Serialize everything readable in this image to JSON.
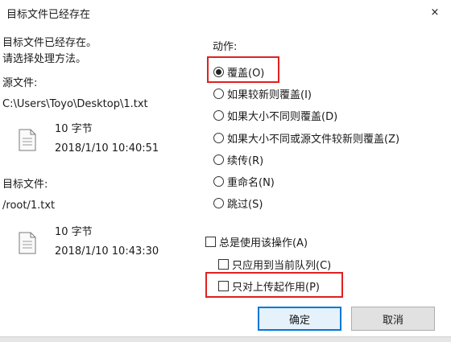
{
  "window": {
    "title": "目标文件已经存在",
    "close_glyph": "×"
  },
  "intro": {
    "line1": "目标文件已经存在。",
    "line2": "请选择处理方法。"
  },
  "source": {
    "label": "源文件:",
    "path": "C:\\Users\\Toyo\\Desktop\\1.txt",
    "size": "10 字节",
    "date": "2018/1/10 10:40:51",
    "icon": "file-icon"
  },
  "target": {
    "label": "目标文件:",
    "path": "/root/1.txt",
    "size": "10 字节",
    "date": "2018/1/10 10:43:30",
    "icon": "file-icon"
  },
  "action": {
    "label": "动作:",
    "options": [
      {
        "label": "覆盖(O)",
        "checked": true
      },
      {
        "label": "如果较新则覆盖(I)",
        "checked": false
      },
      {
        "label": "如果大小不同则覆盖(D)",
        "checked": false
      },
      {
        "label": "如果大小不同或源文件较新则覆盖(Z)",
        "checked": false
      },
      {
        "label": "续传(R)",
        "checked": false
      },
      {
        "label": "重命名(N)",
        "checked": false
      },
      {
        "label": "跳过(S)",
        "checked": false
      }
    ]
  },
  "options": {
    "always": {
      "label": "总是使用该操作(A)",
      "checked": false
    },
    "queue_only": {
      "label": "只应用到当前队列(C)",
      "checked": false
    },
    "upload_only": {
      "label": "只对上传起作用(P)",
      "checked": false
    }
  },
  "buttons": {
    "ok": "确定",
    "cancel": "取消"
  },
  "colors": {
    "highlight": "#e02020",
    "default_button_border": "#0078d7"
  }
}
